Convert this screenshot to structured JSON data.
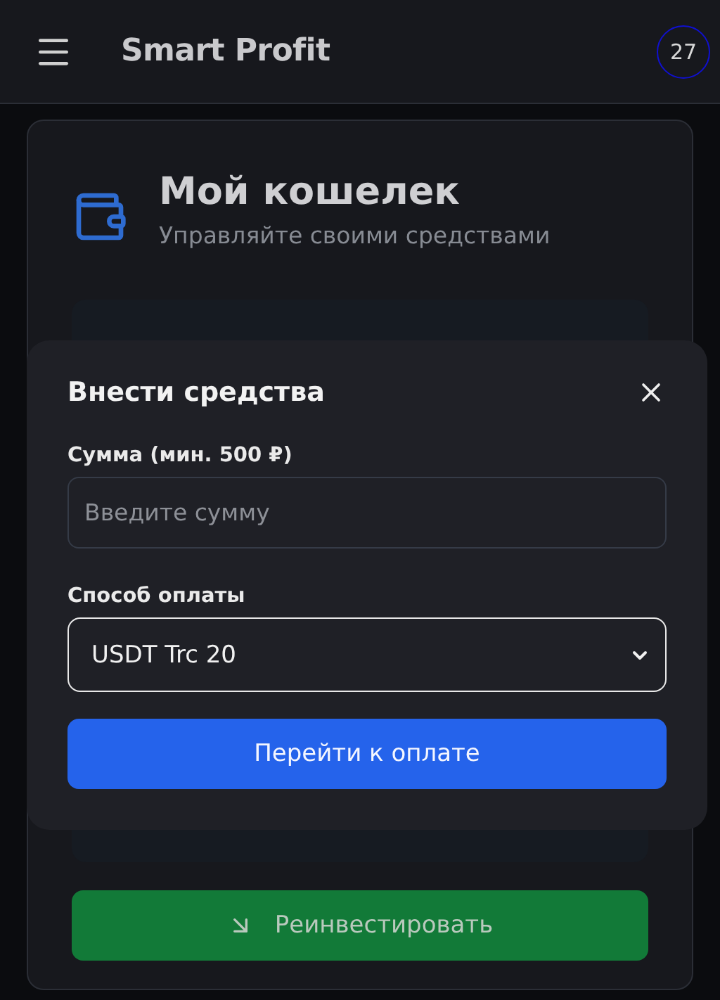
{
  "header": {
    "title": "Smart Profit",
    "badge": "27"
  },
  "wallet": {
    "title": "Мой кошелек",
    "subtitle": "Управляйте своими средствами",
    "reinvest_button": "Реинвестировать"
  },
  "deposit_dialog": {
    "title": "Внести средства",
    "amount": {
      "label": "Сумма (мин. 500 ₽)",
      "placeholder": "Введите сумму"
    },
    "payment": {
      "label": "Способ оплаты",
      "value": "USDT Trc 20"
    },
    "submit": "Перейти к оплате"
  }
}
